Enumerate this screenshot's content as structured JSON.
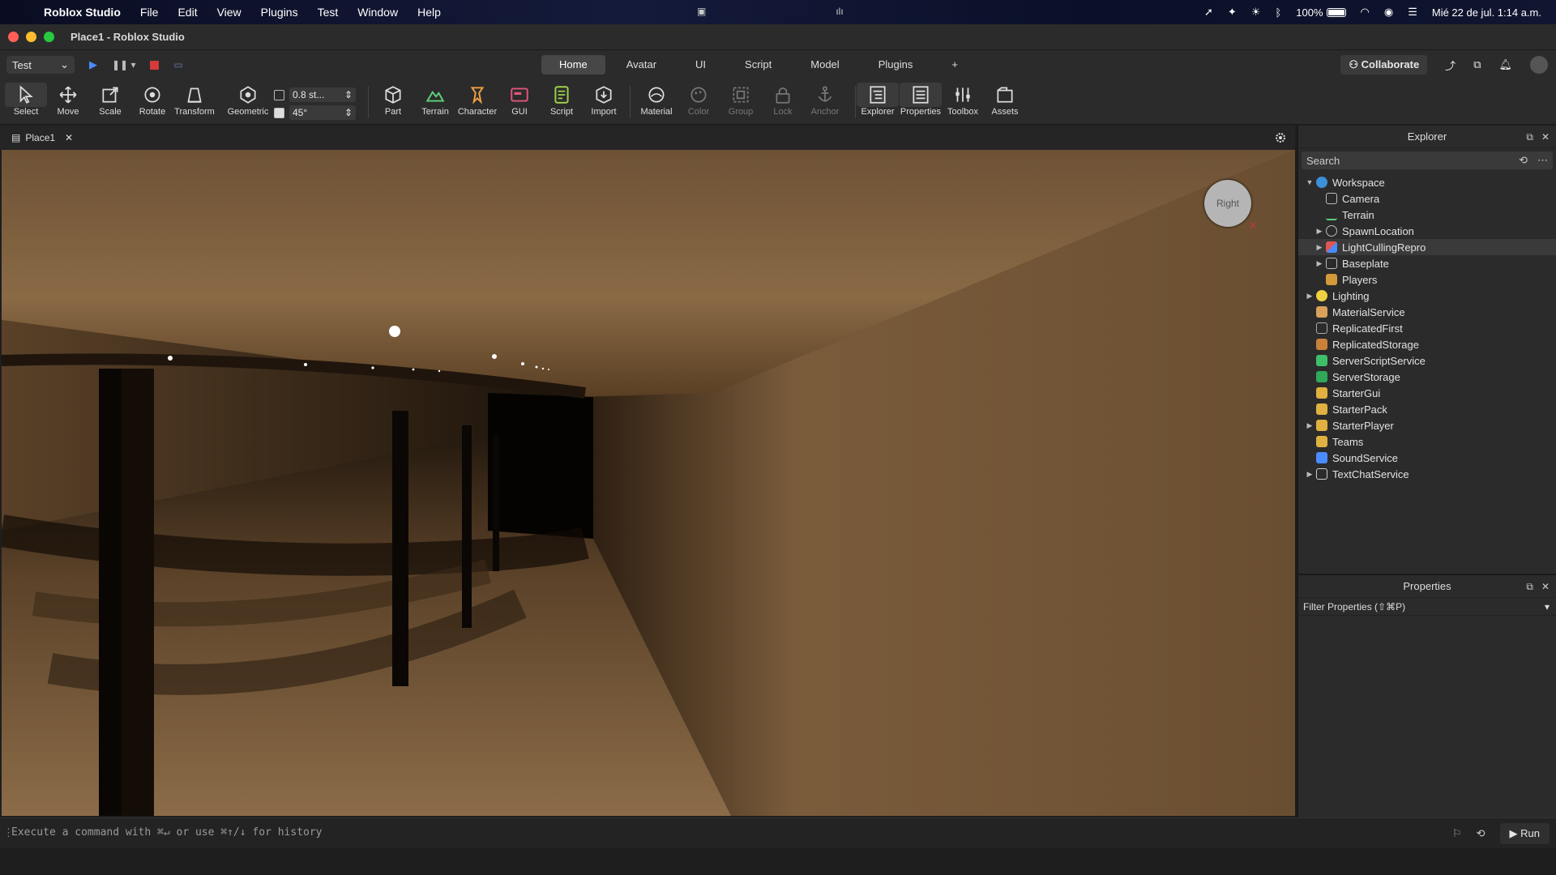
{
  "menubar": {
    "app_name": "Roblox Studio",
    "items": [
      "File",
      "Edit",
      "View",
      "Plugins",
      "Test",
      "Window",
      "Help"
    ],
    "battery": "100%",
    "datetime": "Mié 22 de jul.  1:14 a.m."
  },
  "window": {
    "title": "Place1 - Roblox Studio"
  },
  "tabrow": {
    "mode": "Test",
    "tabs": [
      "Home",
      "Avatar",
      "UI",
      "Script",
      "Model",
      "Plugins",
      "+"
    ],
    "active_tab": "Home",
    "collaborate": "Collaborate"
  },
  "toolbar": {
    "tools": [
      "Select",
      "Move",
      "Scale",
      "Rotate",
      "Transform",
      "Geometric",
      "Part",
      "Terrain",
      "Character",
      "GUI",
      "Script",
      "Import",
      "Material",
      "Color",
      "Group",
      "Lock",
      "Anchor",
      "Explorer",
      "Properties",
      "Toolbox",
      "Assets"
    ],
    "move_snap": "0.8 st...",
    "rotate_snap": "45°"
  },
  "document": {
    "tab": "Place1"
  },
  "viewport": {
    "view_cube_label": "Right",
    "axis_label": "X"
  },
  "explorer": {
    "title": "Explorer",
    "search_placeholder": "Search",
    "items": [
      {
        "label": "Workspace",
        "expanded": true
      },
      {
        "label": "Camera"
      },
      {
        "label": "Terrain"
      },
      {
        "label": "SpawnLocation"
      },
      {
        "label": "LightCullingRepro"
      },
      {
        "label": "Baseplate"
      },
      {
        "label": "Players"
      },
      {
        "label": "Lighting"
      },
      {
        "label": "MaterialService"
      },
      {
        "label": "ReplicatedFirst"
      },
      {
        "label": "ReplicatedStorage"
      },
      {
        "label": "ServerScriptService"
      },
      {
        "label": "ServerStorage"
      },
      {
        "label": "StarterGui"
      },
      {
        "label": "StarterPack"
      },
      {
        "label": "StarterPlayer"
      },
      {
        "label": "Teams"
      },
      {
        "label": "SoundService"
      },
      {
        "label": "TextChatService"
      }
    ]
  },
  "properties": {
    "title": "Properties",
    "filter_placeholder": "Filter Properties (⇧⌘P)"
  },
  "command_bar": {
    "placeholder": "Execute a command with ⌘↵ or use ⌘↑/↓ for history",
    "run": "Run"
  },
  "colors": {
    "accent_blue": "#4a8cff",
    "stop_red": "#d63a3a",
    "panel_bg": "#2b2b2b",
    "wall_tone": "#8a6a45"
  }
}
